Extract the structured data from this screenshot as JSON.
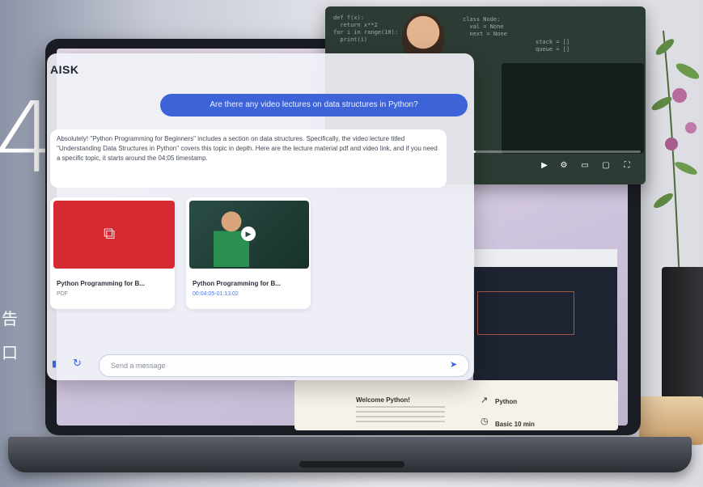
{
  "banner": {
    "big_glyph": "4",
    "side_char_1": "告",
    "side_char_2": "口"
  },
  "chat": {
    "title": "AISK",
    "user_message": "Are there any video lectures on data structures in Python?",
    "ai_message": "Absolutely! \"Python Programming for Beginners\" includes a section on data structures. Specifically, the video lecture titled \"Understanding Data Structures in Python\" covers this topic in depth. Here are the lecture material pdf and video link, and if you need a specific topic, it starts around the 04:05 timestamp.",
    "attachments": [
      {
        "title": "Python Programming for B...",
        "subtitle": "PDF",
        "kind": "pdf"
      },
      {
        "title": "Python Programming for B...",
        "subtitle": "00:04:05-01:13:02",
        "kind": "video"
      }
    ],
    "input_placeholder": "Send a message"
  },
  "video_player": {
    "progress_fraction": 0.02,
    "controls": [
      "play-icon",
      "settings-icon",
      "captions-icon",
      "miniplayer-icon",
      "fullscreen-icon"
    ]
  },
  "lecture_card": {
    "title": "Welcome Python!",
    "right_1": "Python",
    "right_2": "Basic 10 min"
  },
  "colors": {
    "accent": "#3d63d8",
    "pdf_red": "#d62a33"
  }
}
